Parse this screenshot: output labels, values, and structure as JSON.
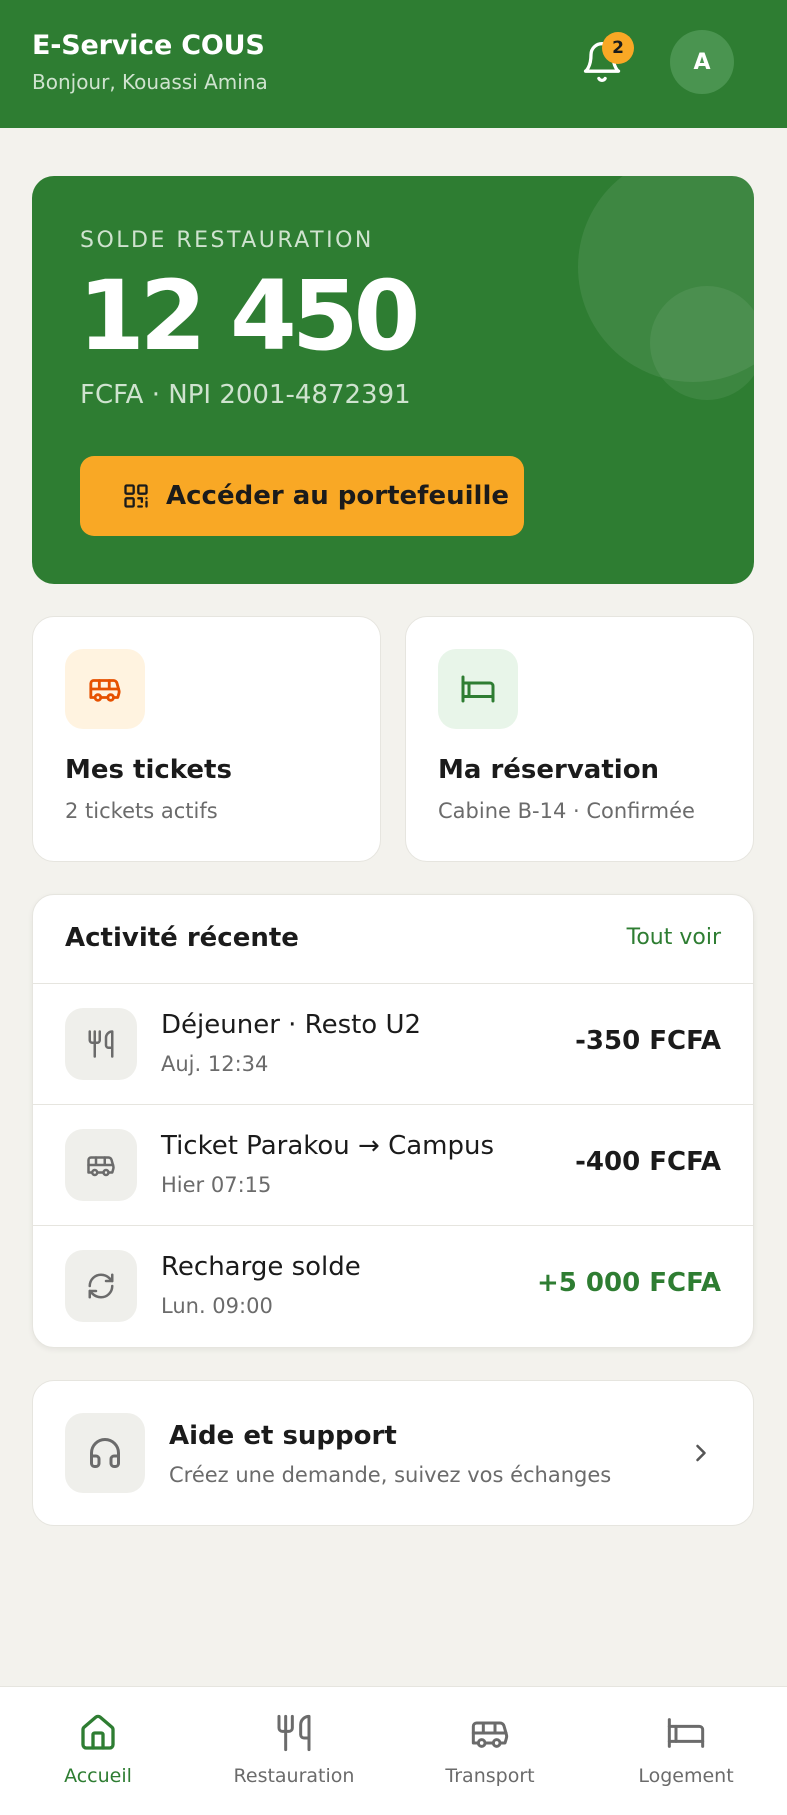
{
  "header": {
    "title": "E-Service COUS",
    "greeting": "Bonjour, Kouassi Amina",
    "notification_count": "2",
    "avatar_initial": "A"
  },
  "balance": {
    "label": "SOLDE RESTAURATION",
    "amount": "12 450",
    "meta": "FCFA · NPI 2001-4872391",
    "button_label": "Accéder au portefeuille"
  },
  "quick": [
    {
      "title": "Mes tickets",
      "subtitle": "2 tickets actifs",
      "icon": "bus-icon"
    },
    {
      "title": "Ma réservation",
      "subtitle": "Cabine B-14 · Confirmée",
      "icon": "bed-icon"
    }
  ],
  "activity": {
    "title": "Activité récente",
    "see_all": "Tout voir",
    "items": [
      {
        "title": "Déjeuner · Resto U2",
        "date": "Auj. 12:34",
        "amount": "-350 FCFA",
        "icon": "utensils-icon"
      },
      {
        "title": "Ticket Parakou → Campus",
        "date": "Hier 07:15",
        "amount": "-400 FCFA",
        "icon": "bus-icon"
      },
      {
        "title": "Recharge solde",
        "date": "Lun. 09:00",
        "amount": "+5 000 FCFA",
        "icon": "refresh-icon"
      }
    ]
  },
  "support": {
    "title": "Aide et support",
    "subtitle": "Créez une demande, suivez vos échanges"
  },
  "nav": [
    {
      "label": "Accueil",
      "icon": "home-icon",
      "active": true
    },
    {
      "label": "Restauration",
      "icon": "utensils-icon",
      "active": false
    },
    {
      "label": "Transport",
      "icon": "bus-icon",
      "active": false
    },
    {
      "label": "Logement",
      "icon": "bed-icon",
      "active": false
    }
  ],
  "colors": {
    "primary": "#2e7d32",
    "accent": "#f9a825",
    "background": "#f3f2ed",
    "positive": "#2e7d32"
  }
}
